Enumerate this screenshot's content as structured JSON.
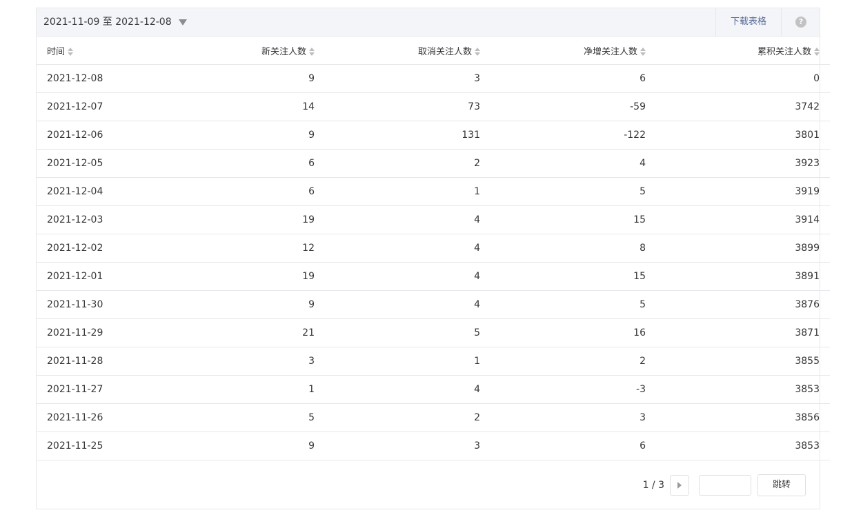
{
  "header": {
    "date_range": "2021-11-09 至 2021-12-08",
    "download_label": "下载表格",
    "help_label": "?"
  },
  "table": {
    "columns": [
      "时间",
      "新关注人数",
      "取消关注人数",
      "净增关注人数",
      "累积关注人数"
    ],
    "rows": [
      [
        "2021-12-08",
        "9",
        "3",
        "6",
        "0"
      ],
      [
        "2021-12-07",
        "14",
        "73",
        "-59",
        "3742"
      ],
      [
        "2021-12-06",
        "9",
        "131",
        "-122",
        "3801"
      ],
      [
        "2021-12-05",
        "6",
        "2",
        "4",
        "3923"
      ],
      [
        "2021-12-04",
        "6",
        "1",
        "5",
        "3919"
      ],
      [
        "2021-12-03",
        "19",
        "4",
        "15",
        "3914"
      ],
      [
        "2021-12-02",
        "12",
        "4",
        "8",
        "3899"
      ],
      [
        "2021-12-01",
        "19",
        "4",
        "15",
        "3891"
      ],
      [
        "2021-11-30",
        "9",
        "4",
        "5",
        "3876"
      ],
      [
        "2021-11-29",
        "21",
        "5",
        "16",
        "3871"
      ],
      [
        "2021-11-28",
        "3",
        "1",
        "2",
        "3855"
      ],
      [
        "2021-11-27",
        "1",
        "4",
        "-3",
        "3853"
      ],
      [
        "2021-11-26",
        "5",
        "2",
        "3",
        "3856"
      ],
      [
        "2021-11-25",
        "9",
        "3",
        "6",
        "3853"
      ]
    ]
  },
  "pagination": {
    "page_info": "1 / 3",
    "input_value": "",
    "jump_label": "跳转"
  },
  "colors": {
    "header_bg": "#f4f5f9",
    "border": "#e7e7eb",
    "link": "#576b95"
  }
}
